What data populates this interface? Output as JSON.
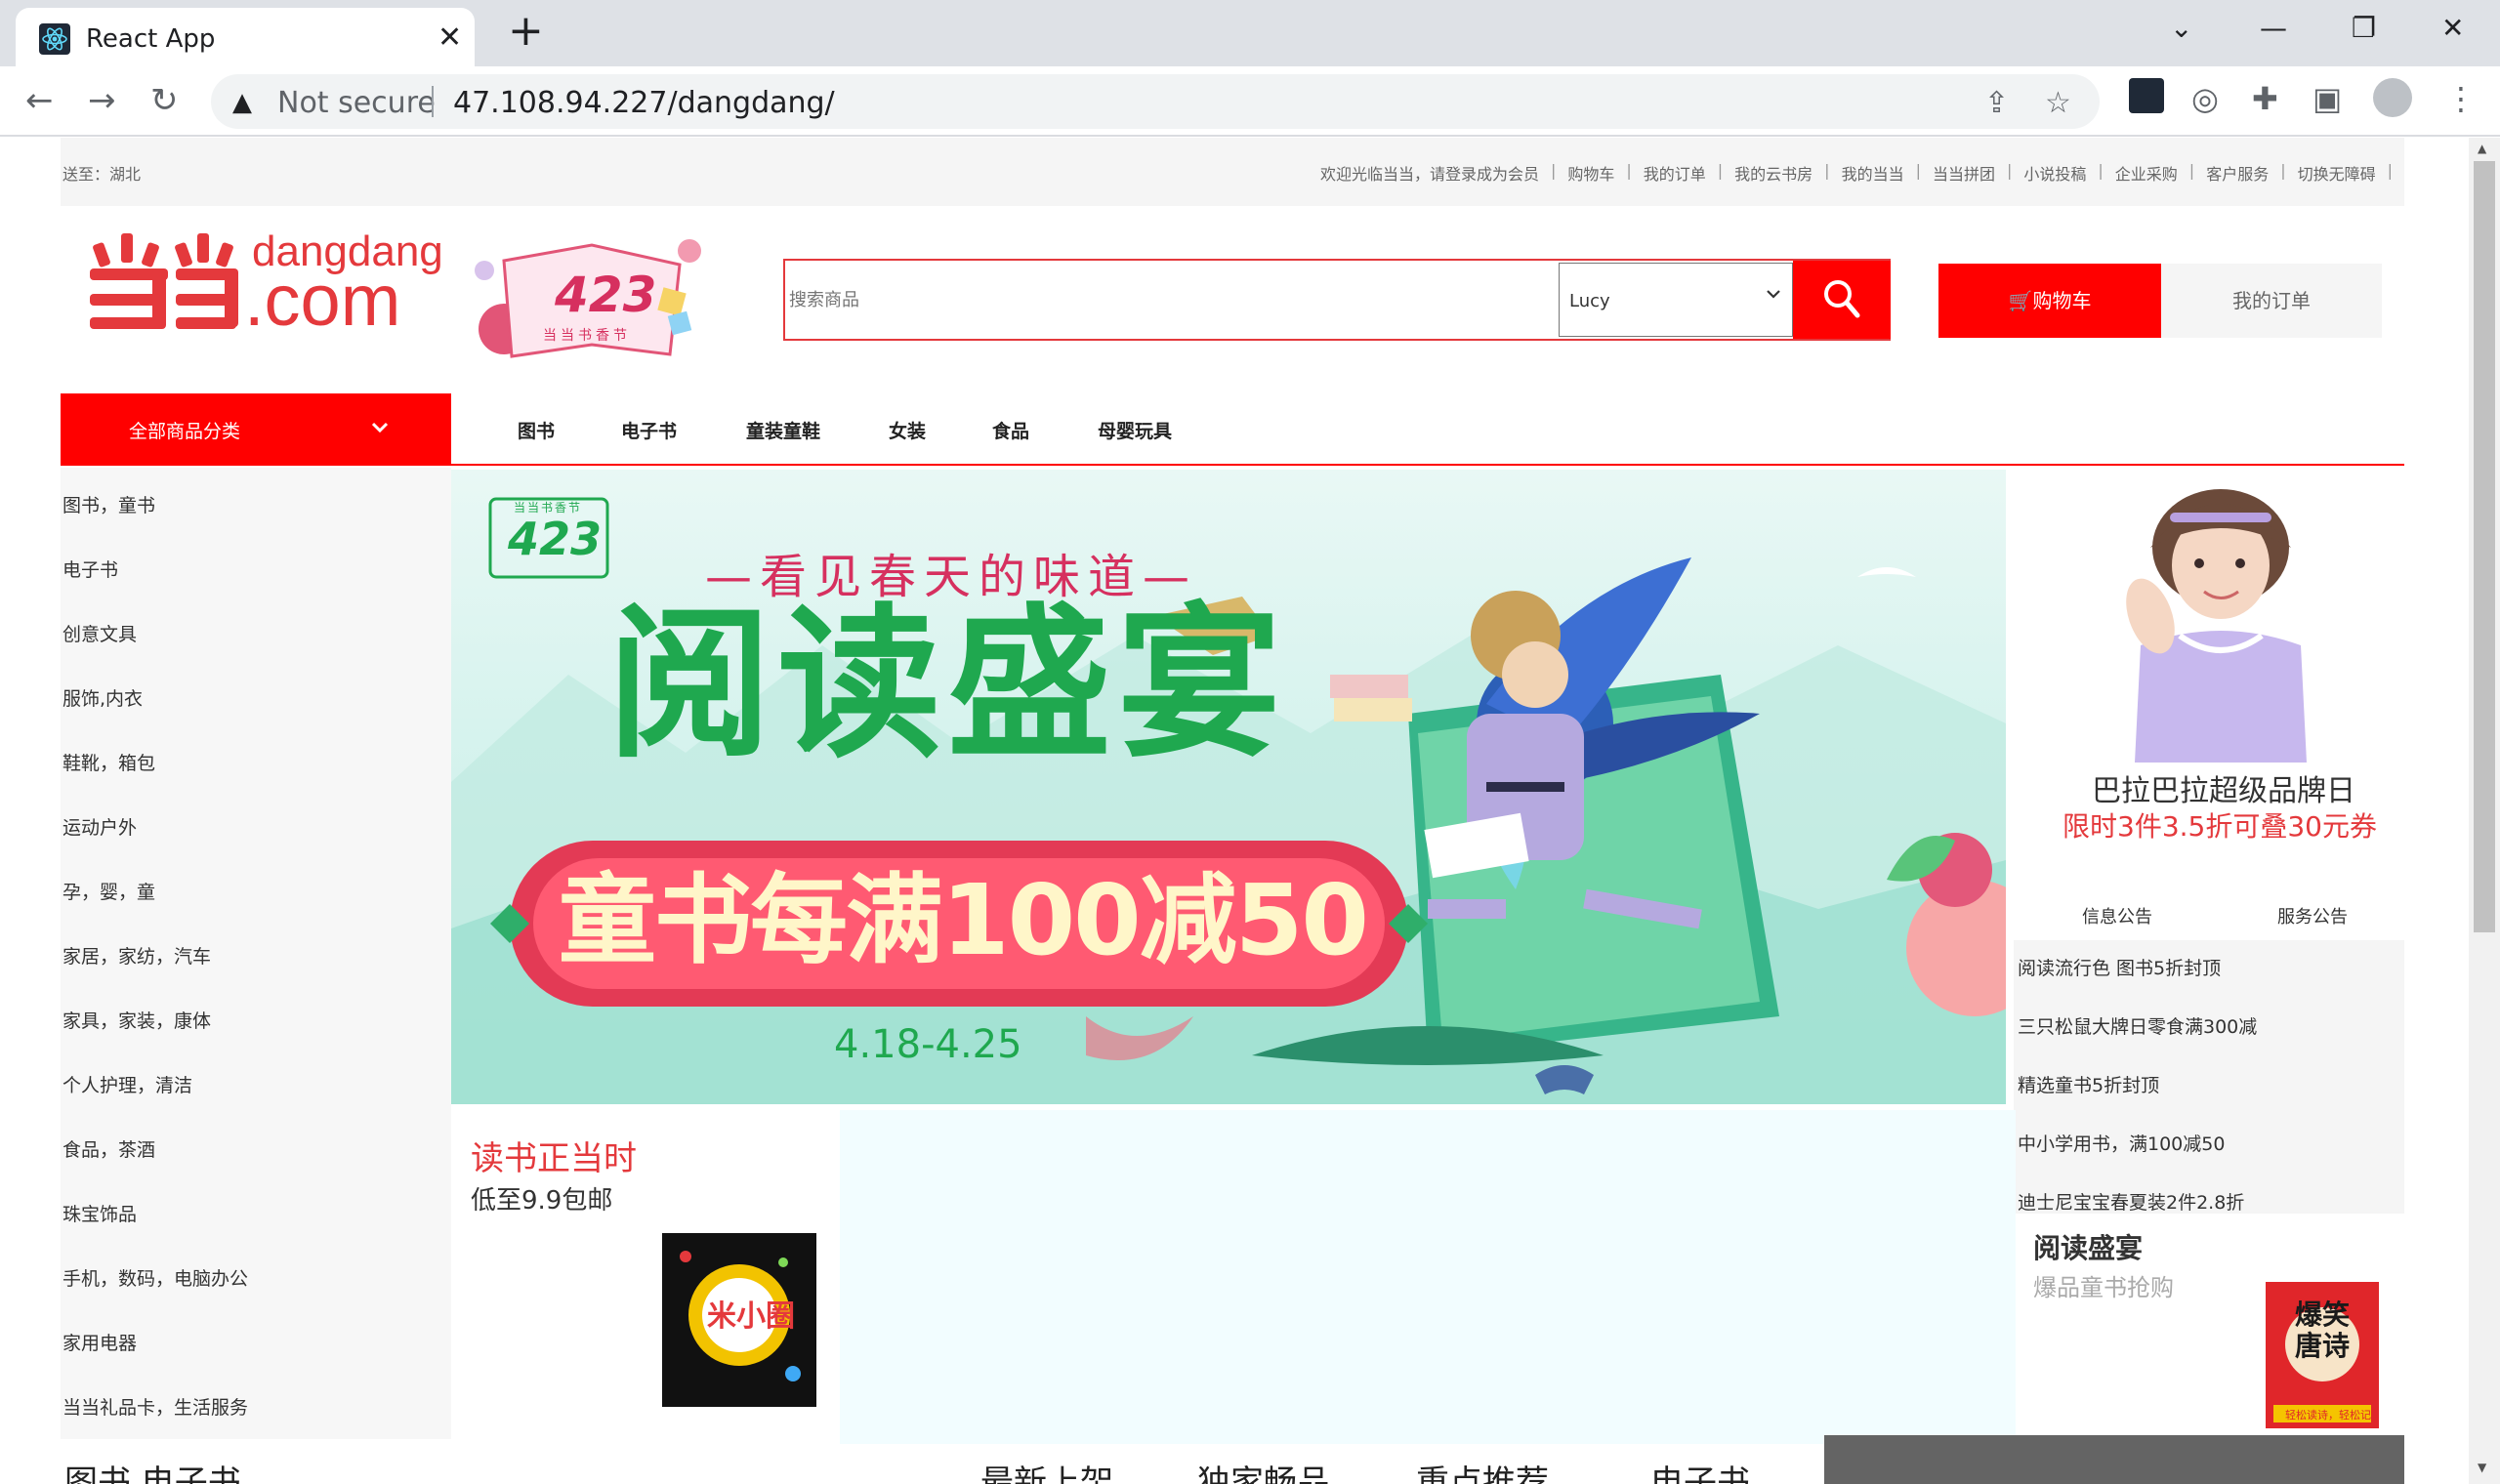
{
  "browser": {
    "tab_title": "React App",
    "tab_close": "✕",
    "new_tab": "+",
    "security_label": "Not secure",
    "url": "47.108.94.227/dangdang/",
    "win_minimize": "—",
    "win_restore": "❐",
    "win_close": "✕",
    "tab_search": "⌄",
    "back": "←",
    "forward": "→",
    "reload": "↻"
  },
  "topbar": {
    "ship_to": "送至：湖北",
    "links": [
      "欢迎光临当当，请登录成为会员",
      "购物车",
      "我的订单",
      "我的云书房",
      "我的当当",
      "当当拼团",
      "小说投稿",
      "企业采购",
      "客户服务",
      "切换无障碍"
    ]
  },
  "header": {
    "logo_text": "dangdang",
    "logo_com": ".com",
    "logo_423_num": "423",
    "logo_423_label": "当当书香节",
    "search_placeholder": "搜索商品",
    "search_select_value": "Lucy",
    "cart_label": "🛒购物车",
    "orders_label": "我的订单"
  },
  "nav": {
    "category_header": "全部商品分类",
    "items": [
      "图书",
      "电子书",
      "童装童鞋",
      "女装",
      "食品",
      "母婴玩具"
    ]
  },
  "sidebar": {
    "items": [
      "图书，童书",
      "电子书",
      "创意文具",
      "服饰,内衣",
      "鞋靴，箱包",
      "运动户外",
      "孕，婴，童",
      "家居，家纺，汽车",
      "家具，家装，康体",
      "个人护理，清洁",
      "食品，茶酒",
      "珠宝饰品",
      "手机，数码，电脑办公",
      "家用电器",
      "当当礼品卡，生活服务"
    ]
  },
  "banner": {
    "badge_label": "当当书香节",
    "badge_num": "423",
    "tagline": "—看见春天的味道—",
    "headline": "阅读盛宴",
    "offer": "童书每满100减50",
    "dates": "4.18-4.25"
  },
  "right_panel": {
    "promo_title": "巴拉巴拉超级品牌日",
    "promo_sub": "限时3件3.5折可叠30元券",
    "tabs": [
      "信息公告",
      "服务公告"
    ],
    "notices": [
      "阅读流行色 图书5折封顶",
      "三只松鼠大牌日零食满300减",
      "精选童书5折封顶",
      "中小学用书，满100减50",
      "迪士尼宝宝春夏装2件2.8折"
    ],
    "reading_title": "阅读盛宴",
    "reading_sub": "爆品童书抢购",
    "book_title": "爆笑唐诗",
    "book_strip": "轻松读诗，轻松记"
  },
  "sub_promo": {
    "title": "读书正当时",
    "sub": "低至9.9包邮",
    "book_title": "米小圈"
  },
  "bottom": {
    "left_heading": "图书 电子书",
    "tabs": [
      "最新上架",
      "独家畅品",
      "重点推荐",
      "电子书"
    ]
  },
  "colors": {
    "brand_red": "#ff0000",
    "promo_red": "#e4393c",
    "banner_green": "#1fa84f"
  }
}
